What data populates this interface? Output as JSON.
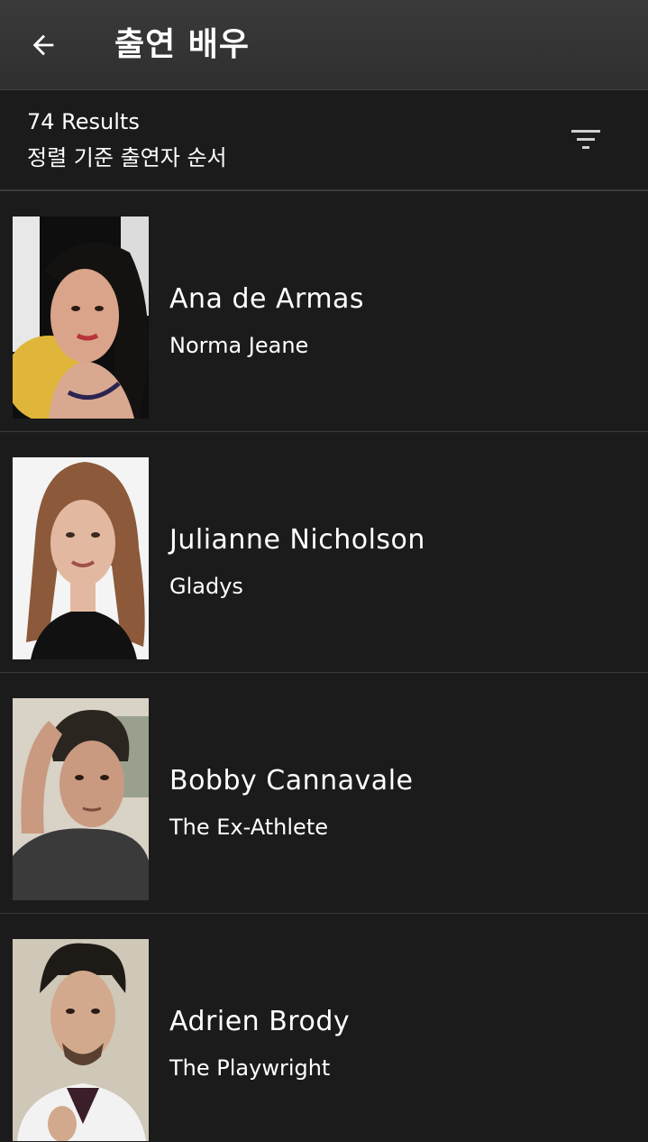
{
  "header": {
    "back_icon": "arrow-back-icon",
    "title": "출연 배우"
  },
  "results": {
    "count_text": "74 Results",
    "sort_text": "정렬 기준 출연자 순서",
    "filter_icon": "filter-icon"
  },
  "cast": [
    {
      "name": "Ana de Armas",
      "role": "Norma Jeane"
    },
    {
      "name": "Julianne Nicholson",
      "role": "Gladys"
    },
    {
      "name": "Bobby Cannavale",
      "role": "The Ex-Athlete"
    },
    {
      "name": "Adrien Brody",
      "role": "The Playwright"
    }
  ],
  "colors": {
    "background": "#1b1b1b",
    "header": "#333333",
    "divider": "#3a3a3a",
    "text": "#ffffff"
  }
}
